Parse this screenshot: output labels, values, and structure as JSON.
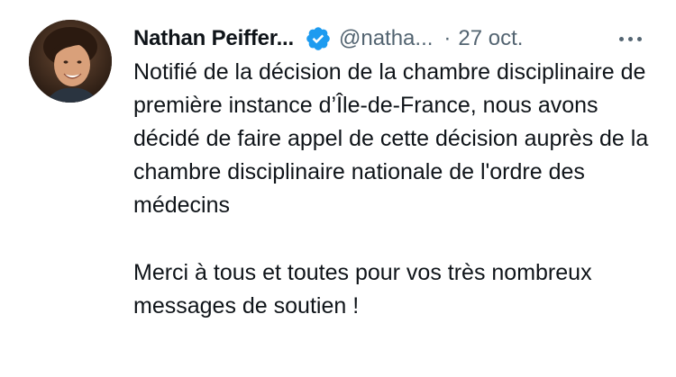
{
  "author": {
    "name": "Nathan Peiffer...",
    "handle": "@natha...",
    "separator": "·",
    "date": "27 oct."
  },
  "icons": {
    "verified": "verified-badge-icon",
    "more": "more-options-icon",
    "verified_color": "#1d9bf0"
  },
  "tweet": {
    "paragraph_1": "Notifié de la décision de la chambre disciplinaire de première instance d’Île-de-France, nous avons décidé de faire appel de cette décision auprès de la chambre disciplinaire nationale de l'ordre des médecins",
    "paragraph_2": "Merci à tous et toutes pour vos très nombreux messages de soutien !"
  },
  "colors": {
    "text_primary": "#0f1419",
    "text_secondary": "#536471",
    "background": "#ffffff"
  }
}
